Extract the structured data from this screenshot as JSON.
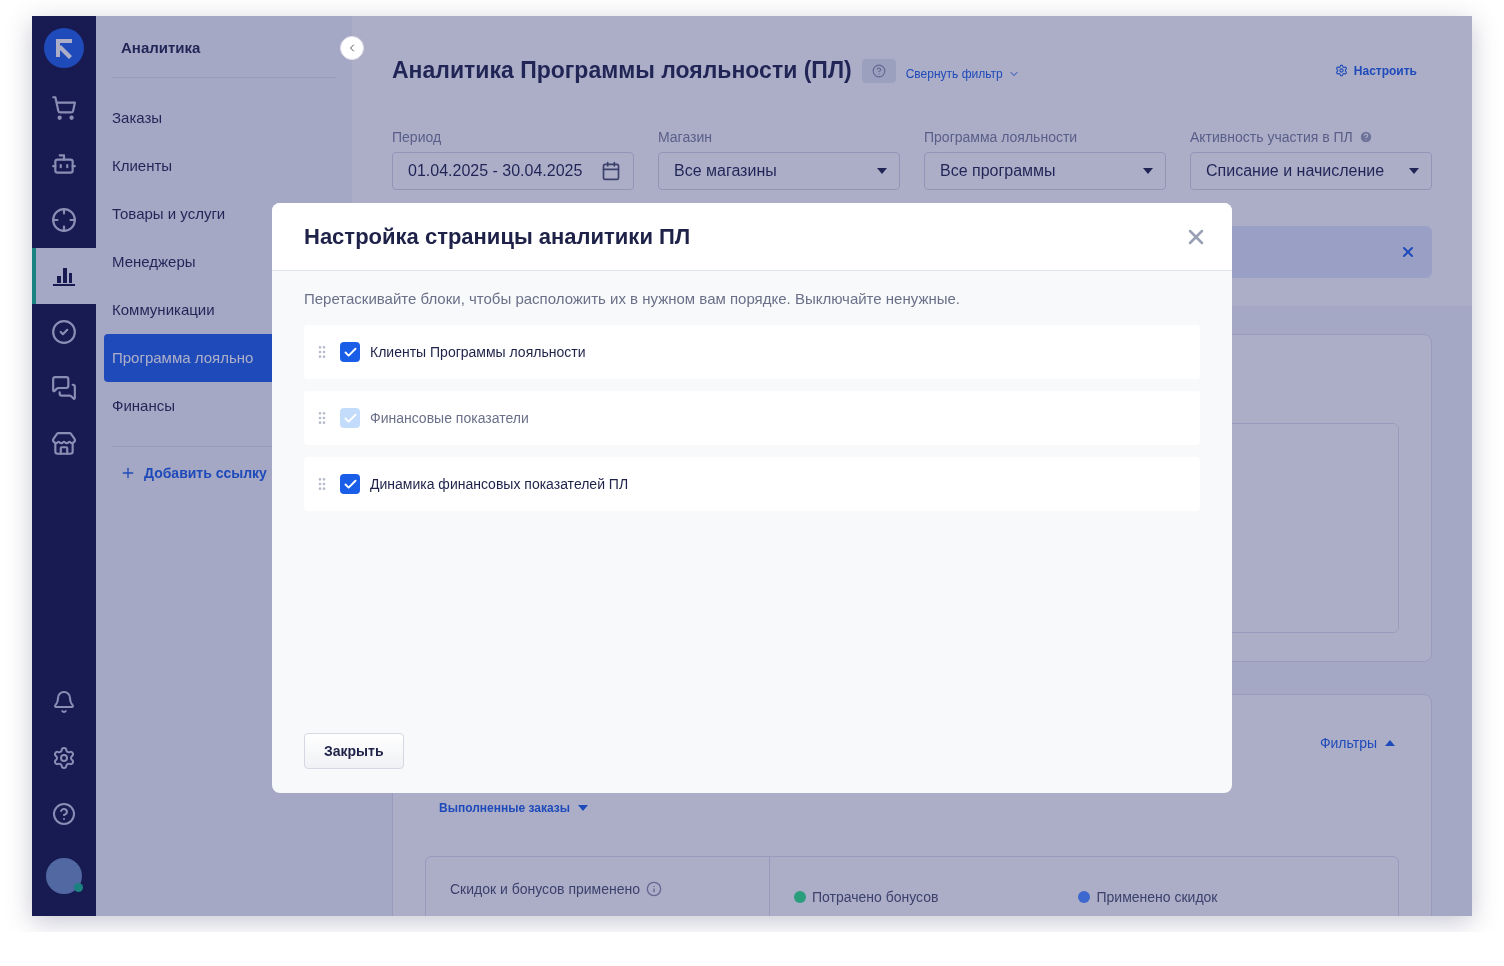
{
  "rail": {
    "items": [
      {
        "selected": false
      },
      {
        "selected": false
      },
      {
        "selected": false
      },
      {
        "selected": true
      },
      {
        "selected": false
      },
      {
        "selected": false
      },
      {
        "selected": false
      }
    ],
    "avatar": {
      "online": true
    }
  },
  "sidebar": {
    "title": "Аналитика",
    "items": [
      {
        "label": "Заказы",
        "selected": false
      },
      {
        "label": "Клиенты",
        "selected": false
      },
      {
        "label": "Товары и услуги",
        "selected": false
      },
      {
        "label": "Менеджеры",
        "selected": false
      },
      {
        "label": "Коммуникации",
        "selected": false
      },
      {
        "label": "Программа лояльно",
        "selected": true
      },
      {
        "label": "Финансы",
        "selected": false
      }
    ],
    "add_link": "Добавить ссылку"
  },
  "page": {
    "title": "Аналитика Программы лояльности (ПЛ)",
    "collapse_filter": "Свернуть фильтр",
    "settings": "Настроить",
    "filters": [
      {
        "label": "Период",
        "value": "01.04.2025 - 30.04.2025",
        "kind": "date",
        "help": false
      },
      {
        "label": "Магазин",
        "value": "Все магазины",
        "kind": "select",
        "help": false
      },
      {
        "label": "Программа лояльности",
        "value": "Все программы",
        "kind": "select",
        "help": false
      },
      {
        "label": "Активность участия в ПЛ",
        "value": "Списание и начисление",
        "kind": "select",
        "help": true
      }
    ],
    "second_card": {
      "filters_toggle": "Фильтры",
      "orders_select": "Выполненные заказы",
      "summary_label": "Скидок и бонусов применено",
      "legend": [
        {
          "label": "Потрачено бонусов",
          "color": "#2a9d7c"
        },
        {
          "label": "Применено скидок",
          "color": "#3d68d0"
        }
      ]
    }
  },
  "modal": {
    "title": "Настройка страницы аналитики ПЛ",
    "hint": "Перетаскивайте блоки, чтобы расположить их в нужном вам порядке. Выключайте ненужные.",
    "blocks": [
      {
        "label": "Клиенты Программы лояльности",
        "checked": true,
        "disabled": false
      },
      {
        "label": "Финансовые показатели",
        "checked": true,
        "disabled": true
      },
      {
        "label": "Динамика финансовых показателей ПЛ",
        "checked": true,
        "disabled": false
      }
    ],
    "close_button": "Закрыть"
  }
}
